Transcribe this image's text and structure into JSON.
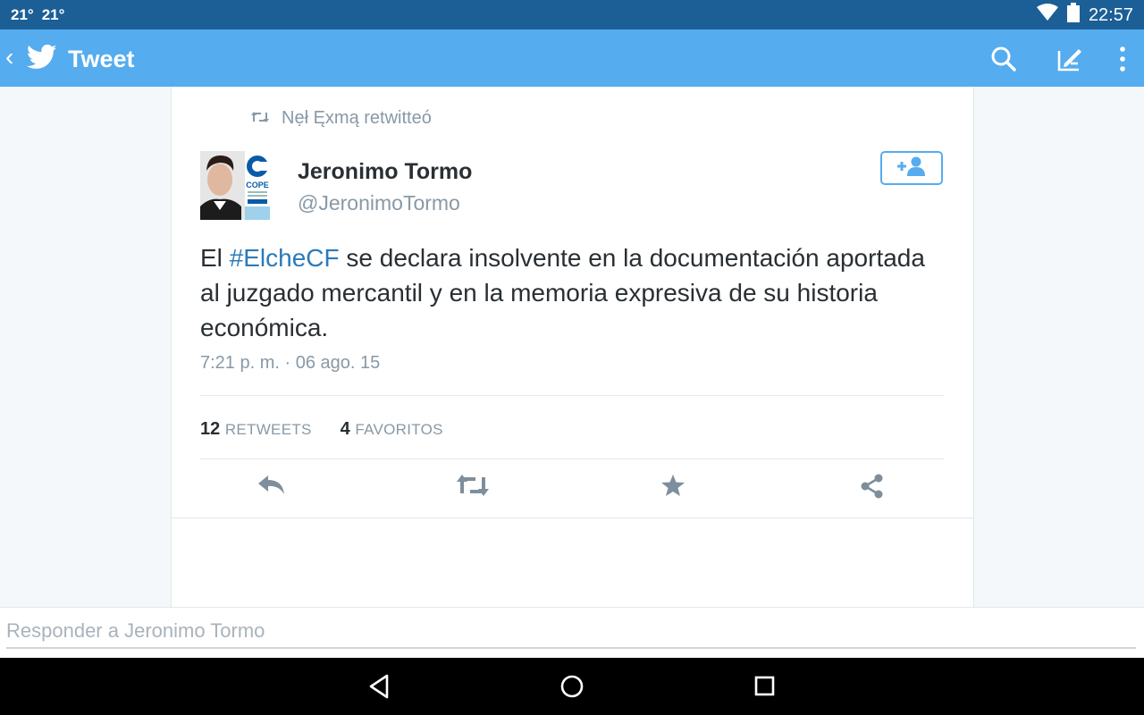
{
  "status_bar": {
    "temp_1": "21°",
    "temp_2": "21°",
    "time": "22:57",
    "icons": [
      "wifi-icon",
      "battery-icon"
    ]
  },
  "app_bar": {
    "title": "Tweet",
    "color": "#55acee",
    "icons": [
      "back-chevron-icon",
      "twitter-bird-icon",
      "search-icon",
      "compose-icon",
      "overflow-menu-icon"
    ]
  },
  "tweet": {
    "retweeted_by": "Nẹł Ęxmą retwitteó",
    "author": {
      "name": "Jeronimo Tormo",
      "handle": "@JeronimoTormo",
      "avatar_logo_text": "COPE"
    },
    "text_before": "El ",
    "hashtag": "#ElcheCF",
    "text_after": " se declara insolvente en la documentación aportada al juzgado mercantil y en la memoria expresiva de su historia económica.",
    "timestamp": "7:21 p. m. · 06 ago. 15",
    "retweets_count": "12",
    "retweets_label": "RETWEETS",
    "favorites_count": "4",
    "favorites_label": "FAVORITOS",
    "actions": [
      "reply-icon",
      "retweet-icon",
      "favorite-star-icon",
      "share-icon"
    ]
  },
  "reply": {
    "placeholder": "Responder a Jeronimo Tormo",
    "value": ""
  },
  "nav_bar": {
    "buttons": [
      "back-triangle-icon",
      "home-circle-icon",
      "recents-square-icon"
    ]
  }
}
